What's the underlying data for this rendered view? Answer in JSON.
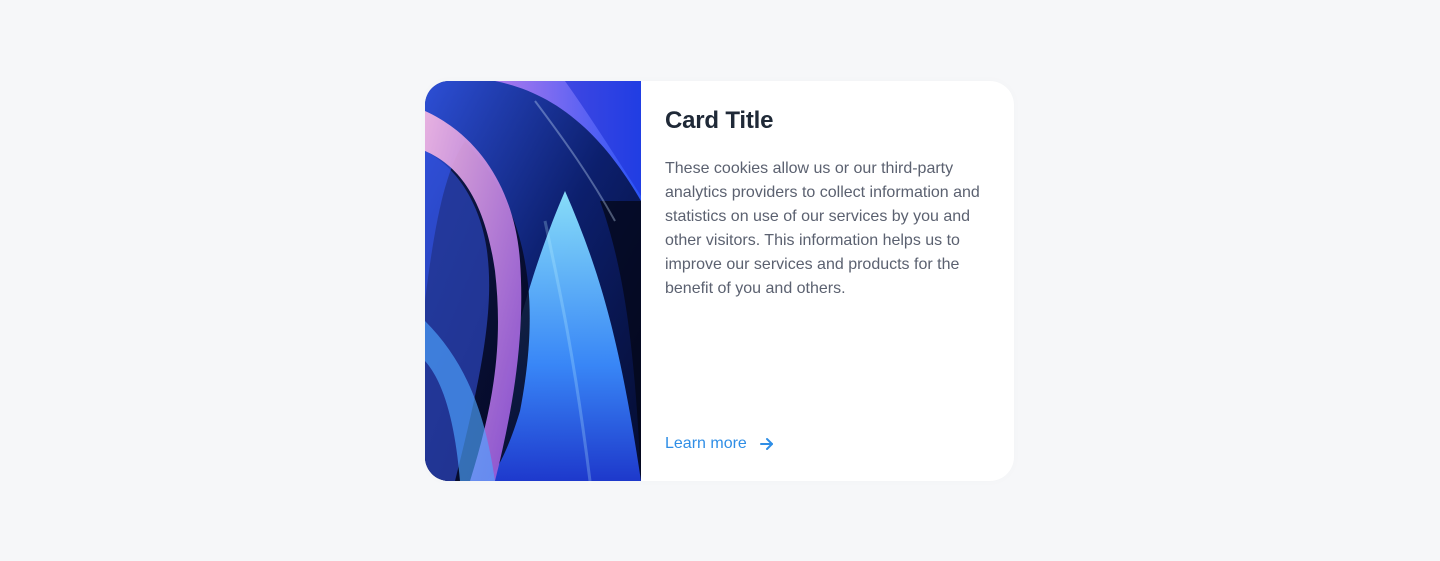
{
  "card": {
    "title": "Card Title",
    "description": "These cookies allow us or our third-party analytics providers to collect information and statistics on use of our services by you and other visitors. This information helps us to improve our services and products for the benefit of you and others.",
    "link_label": "Learn more",
    "link_icon": "arrow-right-icon",
    "image_icon": "abstract-blue-waves-image"
  },
  "colors": {
    "background": "#f6f7f9",
    "card": "#ffffff",
    "title": "#1f2937",
    "body": "#5b6170",
    "link": "#2f8ee6"
  }
}
